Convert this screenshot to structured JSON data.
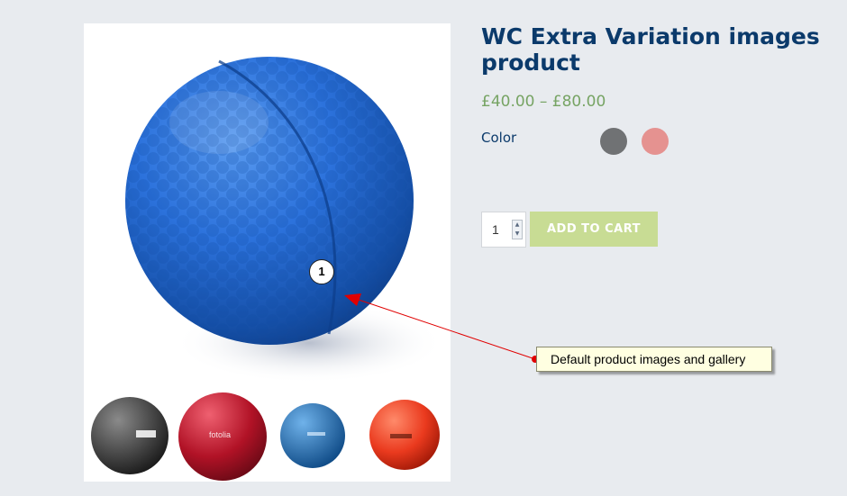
{
  "product": {
    "title": "WC Extra Variation images product",
    "price": "£40.00 – £80.00",
    "color_label": "Color",
    "swatches": [
      {
        "name": "grey",
        "color": "#707274"
      },
      {
        "name": "pink",
        "color": "#e59290"
      }
    ],
    "quantity": "1",
    "add_to_cart_label": "ADD TO CART"
  },
  "gallery": {
    "main_image_icon": "blue-foam-golf-ball",
    "thumbnails": [
      {
        "icon": "black-exercise-ball",
        "label": "",
        "color": "#3a3a3a"
      },
      {
        "icon": "red-exercise-ball",
        "label": "fotolia",
        "color": "#b11226"
      },
      {
        "icon": "blue-exercise-ball",
        "label": "",
        "color": "#1f6fb5"
      },
      {
        "icon": "orange-exercise-ball",
        "label": "",
        "color": "#ea3a1e"
      }
    ]
  },
  "annotation": {
    "marker_number": "1",
    "callout_text": "Default product images and gallery",
    "arrow_color": "#e00000"
  }
}
